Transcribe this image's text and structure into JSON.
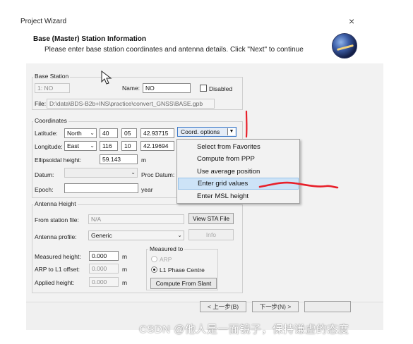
{
  "window": {
    "title": "Project Wizard",
    "close": "×"
  },
  "header": {
    "title": "Base (Master) Station Information",
    "subtitle": "Please enter base station coordinates and antenna details. Click \"Next\" to continue"
  },
  "base_station": {
    "group_label": "Base Station",
    "station_id": "1: NO",
    "name_label": "Name:",
    "name_value": "NO",
    "disabled_label": "Disabled",
    "file_label": "File:",
    "file_value": "D:\\data\\BDS-B2b+INS\\practice\\convert_GNSS\\BASE.gpb"
  },
  "coordinates": {
    "group_label": "Coordinates",
    "latitude_label": "Latitude:",
    "latitude_dir": "North",
    "latitude_deg": "40",
    "latitude_min": "05",
    "latitude_sec": "42.93715",
    "longitude_label": "Longitude:",
    "longitude_dir": "East",
    "longitude_deg": "116",
    "longitude_min": "10",
    "longitude_sec": "42.19694",
    "height_label": "Ellipsoidal height:",
    "height_value": "59.143",
    "height_unit": "m",
    "datum_label": "Datum:",
    "proc_datum_label": "Proc Datum:",
    "epoch_label": "Epoch:",
    "epoch_unit": "year",
    "coord_options_label": "Coord. options"
  },
  "coord_menu": {
    "items": [
      "Select from Favorites",
      "Compute from PPP",
      "Use average position",
      "Enter grid values",
      "Enter MSL height"
    ],
    "highlighted": "Enter grid values"
  },
  "antenna": {
    "group_label": "Antenna Height",
    "from_station_label": "From station file:",
    "from_station_value": "N/A",
    "view_sta_label": "View STA File",
    "profile_label": "Antenna profile:",
    "profile_value": "Generic",
    "info_label": "Info",
    "measured_height_label": "Measured height:",
    "measured_height_value": "0.000",
    "arp_offset_label": "ARP to L1 offset:",
    "arp_offset_value": "0.000",
    "applied_height_label": "Applied height:",
    "applied_height_value": "0.000",
    "unit": "m",
    "measured_to_label": "Measured to",
    "arp_option": "ARP",
    "l1_option": "L1 Phase Centre",
    "compute_slant_label": "Compute From Slant"
  },
  "footer": {
    "back_label": "< 上一步(B)",
    "next_label": "下一步(N) >"
  },
  "watermark": "CSDN @他人是一面镜子，保持谦虚的态度",
  "colors": {
    "annotation_red": "#e8202a",
    "highlight": "#cde3f7"
  }
}
